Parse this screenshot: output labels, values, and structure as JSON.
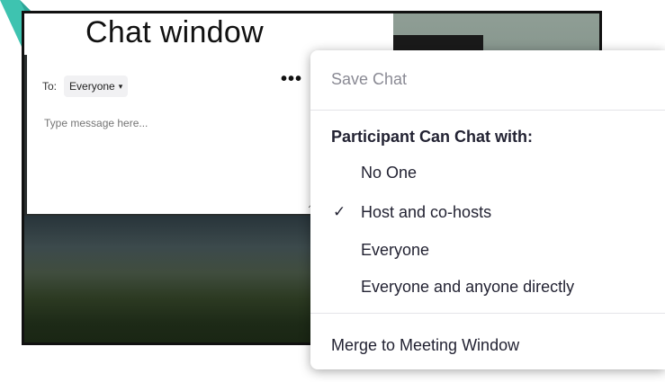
{
  "annotation": {
    "title": "Chat window",
    "arrow_color": "#3ec3b0"
  },
  "chat": {
    "to_label": "To:",
    "recipient": "Everyone",
    "more_label": "•••",
    "message_placeholder": "Type message here..."
  },
  "menu": {
    "save_chat": "Save Chat",
    "section_label": "Participant Can Chat with:",
    "options": [
      {
        "label": "No One",
        "checked": false
      },
      {
        "label": "Host and co-hosts",
        "checked": true
      },
      {
        "label": "Everyone",
        "checked": false
      },
      {
        "label": "Everyone and anyone directly",
        "checked": false
      }
    ],
    "checkmark": "✓",
    "merge": "Merge to Meeting Window"
  }
}
